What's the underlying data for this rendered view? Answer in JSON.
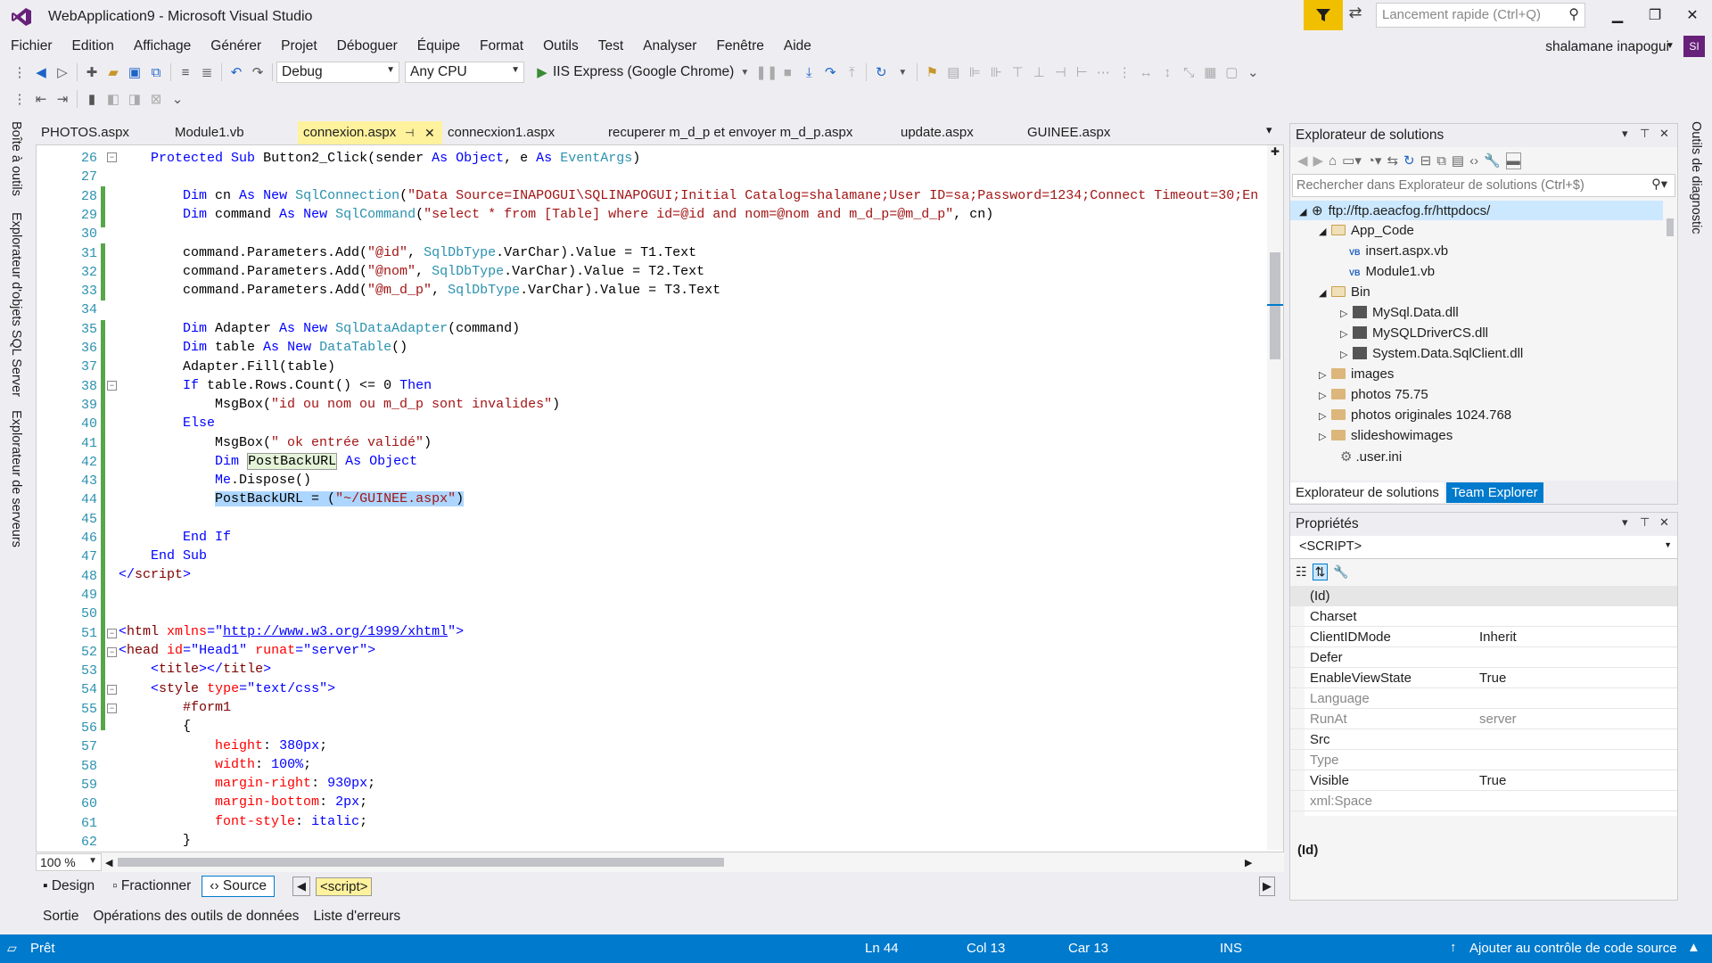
{
  "window": {
    "title": "WebApplication9 - Microsoft Visual Studio",
    "quick_launch_placeholder": "Lancement rapide (Ctrl+Q)",
    "user_name": "shalamane inapogui",
    "user_initials": "SI"
  },
  "menu": [
    "Fichier",
    "Edition",
    "Affichage",
    "Générer",
    "Projet",
    "Déboguer",
    "Équipe",
    "Format",
    "Outils",
    "Test",
    "Analyser",
    "Fenêtre",
    "Aide"
  ],
  "toolbar": {
    "config": "Debug",
    "platform": "Any CPU",
    "run_target": "IIS Express (Google Chrome)"
  },
  "left_rail": [
    "Boîte à outils",
    "Explorateur d'objets SQL Server",
    "Explorateur de serveurs"
  ],
  "right_rail": [
    "Outils de diagnostic"
  ],
  "tabs": [
    {
      "label": "PHOTOS.aspx"
    },
    {
      "label": "Module1.vb"
    },
    {
      "label": "connexion.aspx"
    },
    {
      "label": "connecxion1.aspx"
    },
    {
      "label": "recuperer m_d_p et envoyer m_d_p.aspx"
    },
    {
      "label": "update.aspx"
    },
    {
      "label": "GUINEE.aspx"
    }
  ],
  "editor": {
    "line_numbers": [
      "26",
      "27",
      "28",
      "29",
      "30",
      "31",
      "32",
      "33",
      "34",
      "35",
      "36",
      "37",
      "38",
      "39",
      "40",
      "41",
      "42",
      "43",
      "44",
      "45",
      "46",
      "47",
      "48",
      "49",
      "50",
      "51",
      "52",
      "53",
      "54",
      "55",
      "56",
      "57",
      "58",
      "59",
      "60",
      "61",
      "62"
    ],
    "zoom": "100 %",
    "views": {
      "design": "Design",
      "split": "Fractionner",
      "source": "Source"
    },
    "breadcrumb": "<script>"
  },
  "bottom_tabs": [
    "Sortie",
    "Opérations des outils de données",
    "Liste d'erreurs"
  ],
  "status": {
    "ready": "Prêt",
    "line": "Ln 44",
    "col": "Col 13",
    "char": "Car 13",
    "mode": "INS",
    "source_control": "Ajouter au contrôle de code source"
  },
  "solution_explorer": {
    "title": "Explorateur de solutions",
    "search_placeholder": "Rechercher dans Explorateur de solutions (Ctrl+$)",
    "tree": [
      "ftp://ftp.aeacfog.fr/httpdocs/",
      "App_Code",
      "insert.aspx.vb",
      "Module1.vb",
      "Bin",
      "MySql.Data.dll",
      "MySQLDriverCS.dll",
      "System.Data.SqlClient.dll",
      "images",
      "photos 75.75",
      "photos originales 1024.768",
      "slideshowimages",
      ".user.ini"
    ],
    "tab_active": "Explorateur de solutions",
    "tab_other": "Team Explorer"
  },
  "properties": {
    "title": "Propriétés",
    "object": "<SCRIPT>",
    "rows": [
      {
        "key": "(Id)",
        "value": ""
      },
      {
        "key": "Charset",
        "value": ""
      },
      {
        "key": "ClientIDMode",
        "value": "Inherit"
      },
      {
        "key": "Defer",
        "value": ""
      },
      {
        "key": "EnableViewState",
        "value": "True"
      },
      {
        "key": "Language",
        "value": ""
      },
      {
        "key": "RunAt",
        "value": "server"
      },
      {
        "key": "Src",
        "value": ""
      },
      {
        "key": "Type",
        "value": ""
      },
      {
        "key": "Visible",
        "value": "True"
      },
      {
        "key": "xml:Space",
        "value": ""
      }
    ],
    "description": "(Id)"
  },
  "colors": {
    "accent": "#007acc",
    "tab_active": "#fff29d",
    "filter": "#f0c000",
    "avatar": "#68217a"
  }
}
